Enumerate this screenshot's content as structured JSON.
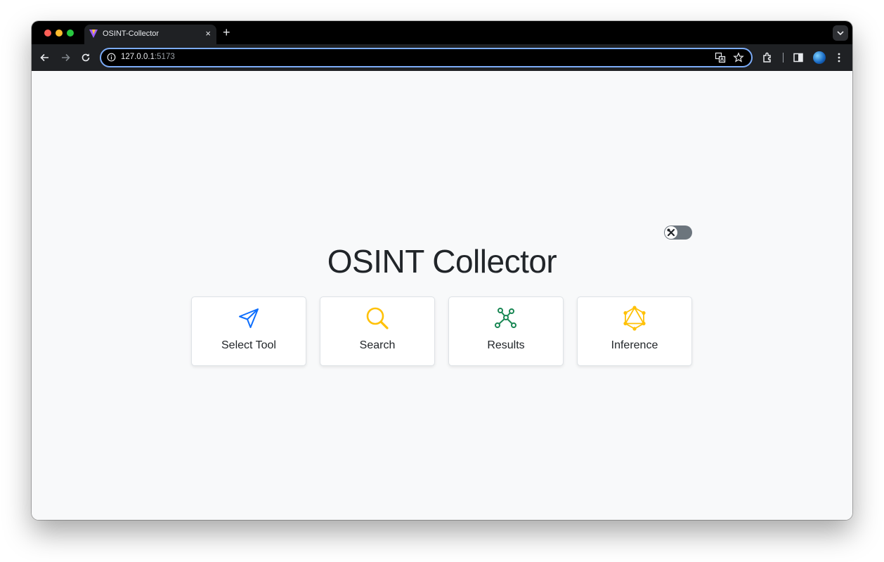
{
  "browser": {
    "tab_title": "OSINT-Collector",
    "tab_close": "×",
    "new_tab": "+",
    "url_host": "127.0.0.1",
    "url_port": ":5173"
  },
  "page": {
    "title": "OSINT Collector",
    "cards": [
      {
        "label": "Select Tool",
        "icon": "send-icon",
        "color": "#0d6efd"
      },
      {
        "label": "Search",
        "icon": "search-icon",
        "color": "#ffc107"
      },
      {
        "label": "Results",
        "icon": "graph-icon",
        "color": "#198754"
      },
      {
        "label": "Inference",
        "icon": "graphql-icon",
        "color": "#ffc107"
      }
    ],
    "toggle_icon": "tools-icon"
  }
}
